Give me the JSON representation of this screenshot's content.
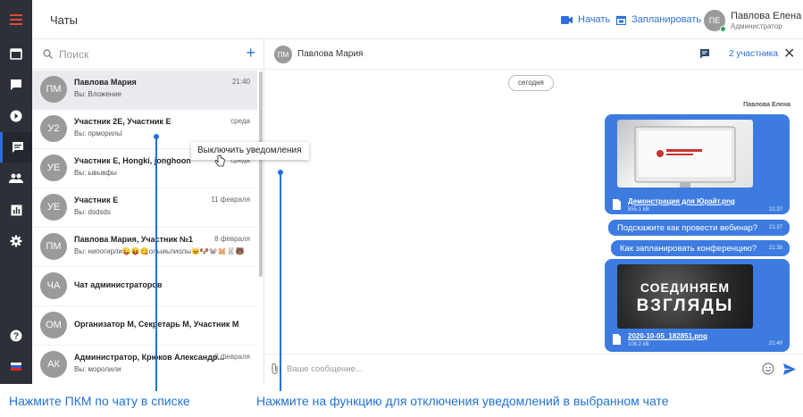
{
  "header": {
    "title": "Чаты",
    "start_label": "Начать",
    "schedule_label": "Запланировать",
    "user": {
      "initials": "ПЕ",
      "name": "Павлова Елена",
      "role": "Администратор"
    }
  },
  "sidebar": {
    "icons": [
      "menu-icon",
      "calendar-icon",
      "messages-icon",
      "play-icon",
      "chat-icon",
      "contacts-icon",
      "stats-icon",
      "settings-icon",
      "help-icon",
      "language-flag-icon"
    ],
    "active": "chat-icon"
  },
  "search": {
    "placeholder": "Поиск"
  },
  "chats": [
    {
      "initials": "ПМ",
      "name": "Павлова Мария",
      "preview": "Вы: Вложение",
      "time": "21:40",
      "selected": true
    },
    {
      "initials": "У2",
      "name": "Участник 2Е, Участник Е",
      "preview": "Вы: прморильl",
      "time": "среда"
    },
    {
      "initials": "УЕ",
      "name": "Участник Е, Hongki, jonghoon",
      "preview": "Вы: ывывфы",
      "time": "среда"
    },
    {
      "initials": "УЕ",
      "name": "Участник Е",
      "preview": "Вы: dsdsds",
      "time": "11 февраля"
    },
    {
      "initials": "ПМ",
      "name": "Павлова Мария, Участник №1",
      "preview": "Вы: нипогирли😜😝😋олыиьлиолы🐱🐶🐭🐹🐰🐻",
      "time": "8 февраля"
    },
    {
      "initials": "ЧА",
      "name": "Чат администраторов",
      "preview": "",
      "time": ""
    },
    {
      "initials": "ОМ",
      "name": "Организатор М, Секретарь М, Участник М",
      "preview": "",
      "time": ""
    },
    {
      "initials": "АК",
      "name": "Администратор, Крюков Александр...",
      "preview": "Вы: моролили",
      "time": "8 февраля"
    }
  ],
  "context_menu": {
    "item": "Выключить уведомления"
  },
  "conversation": {
    "initials": "ПМ",
    "name": "Павлова Мария",
    "participants": "2 участника",
    "day_divider": "сегодня",
    "sender": "Павлова Елена",
    "messages": [
      {
        "type": "file",
        "file_name": "Демонстрация для Юрайт.png",
        "file_size": "855.1 kB",
        "time": "21:37"
      },
      {
        "type": "text",
        "text": "Подскажите как провести вебинар?",
        "time": "21:37"
      },
      {
        "type": "text",
        "text": "Как запланировать конференцию?",
        "time": "21:38"
      },
      {
        "type": "file",
        "file_name": "2020-10-05_182851.png",
        "file_size": "108.2 kB",
        "time": "21:40",
        "image_text_1": "СОЕДИНЯЕМ",
        "image_text_2": "ВЗГЛЯДЫ"
      }
    ],
    "composer_placeholder": "Ваше сообщение..."
  },
  "annotations": {
    "left": "Нажмите ПКМ по чату в списке",
    "right": "Нажмите на функцию для отключения уведомлений в выбранном чате"
  },
  "colors": {
    "accent": "#2e6fd9",
    "bubble": "#3d7be0",
    "rail": "#2c3038",
    "annotation": "#1e73d8"
  }
}
